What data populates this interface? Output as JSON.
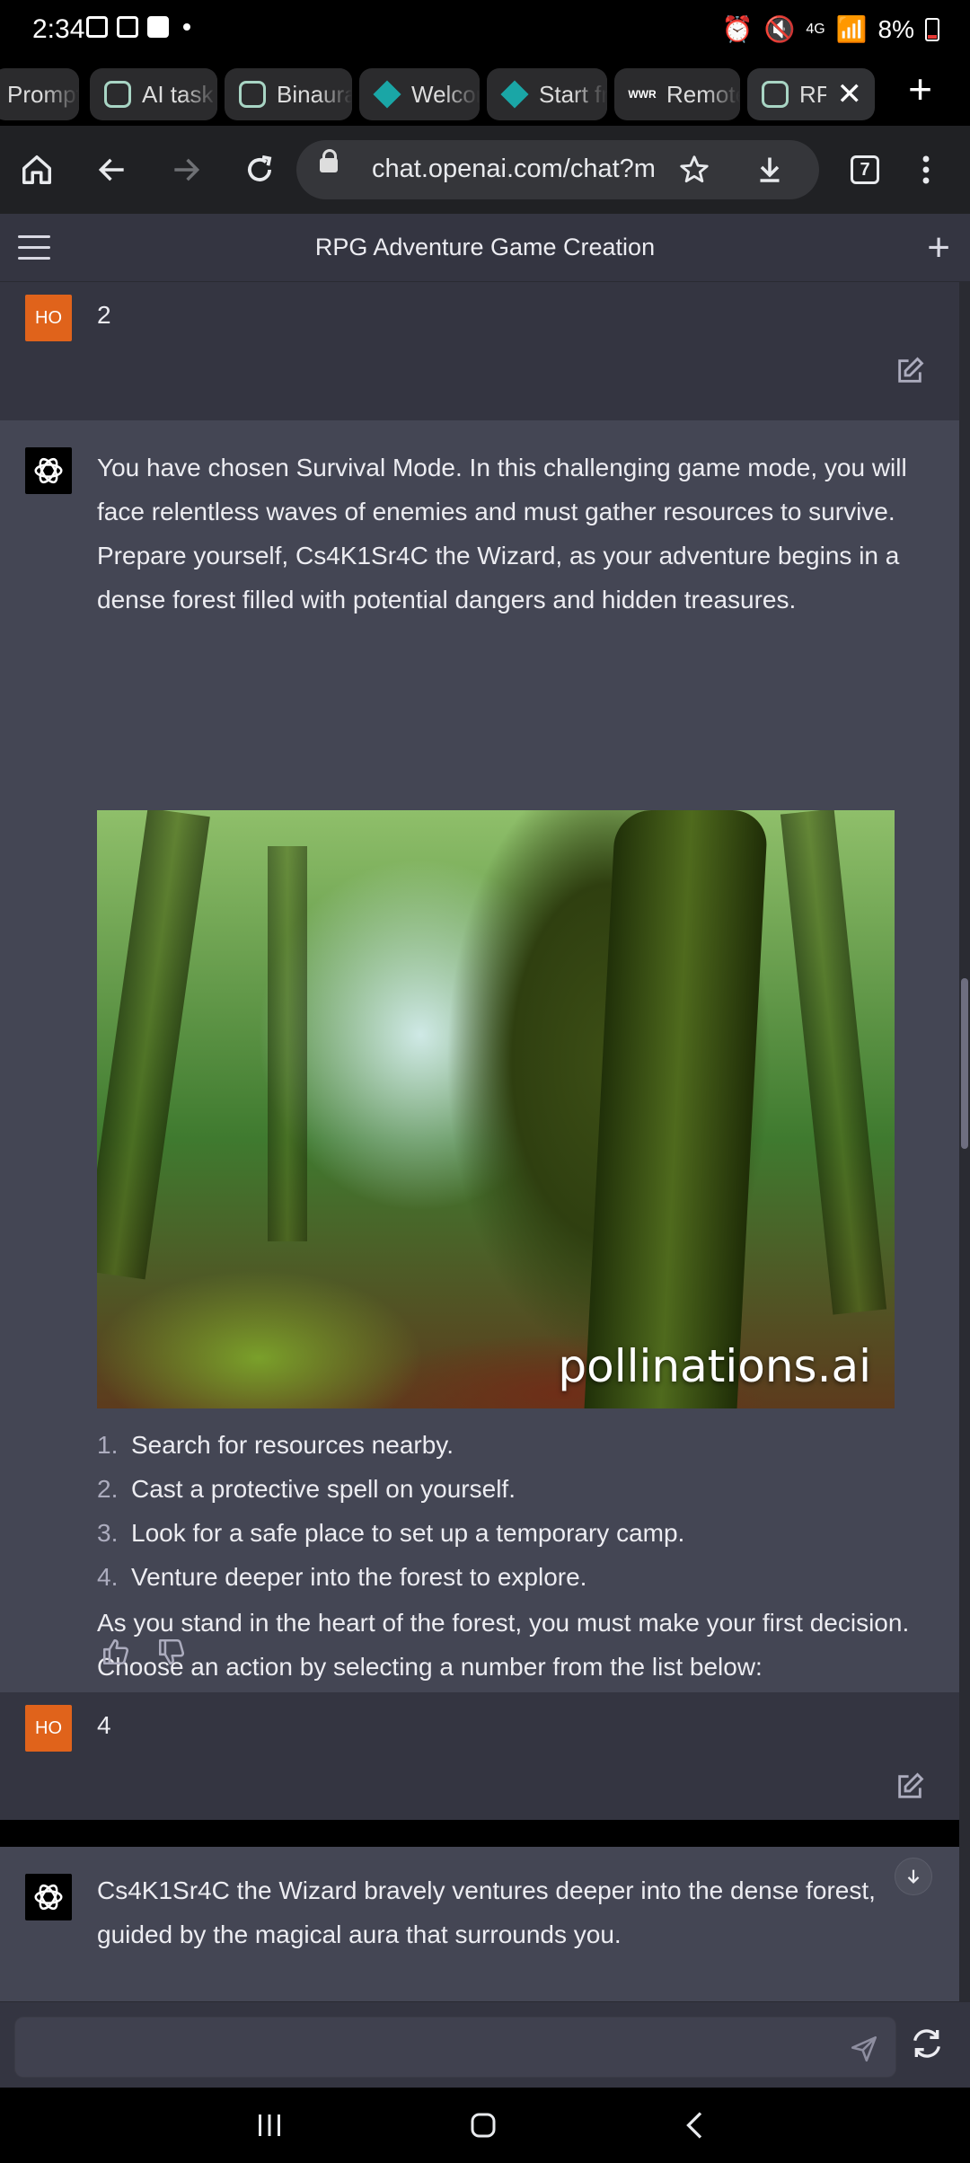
{
  "status_bar": {
    "time": "2:34",
    "network": "4G",
    "battery": "8%"
  },
  "tabs": [
    {
      "title": "Prompt",
      "favicon": "none"
    },
    {
      "title": "AI task",
      "favicon": "chatgpt"
    },
    {
      "title": "Binaural",
      "favicon": "chatgpt"
    },
    {
      "title": "Welcome",
      "favicon": "diamond"
    },
    {
      "title": "Start fr",
      "favicon": "diamond"
    },
    {
      "title": "Remote",
      "favicon": "wwr"
    },
    {
      "title": "RPG",
      "favicon": "chatgpt"
    }
  ],
  "wwr_favicon_text": "WWR",
  "browser": {
    "url": "chat.openai.com/chat?model",
    "tab_count": "7"
  },
  "chat": {
    "title": "RPG Adventure Game Creation",
    "user_avatar": "HO",
    "messages": [
      {
        "role": "user",
        "text": "2"
      },
      {
        "role": "assistant",
        "intro": "You have chosen Survival Mode. In this challenging game mode, you will face relentless waves of enemies and must gather resources to survive. Prepare yourself, Cs4K1Sr4C the Wizard, as your adventure begins in a dense forest filled with potential dangers and hidden treasures.",
        "image_watermark": "pollinations.ai",
        "prompt": "As you stand in the heart of the forest, you must make your first decision. Choose an action by selecting a number from the list below:",
        "choices": [
          {
            "num": "1.",
            "text": "Search for resources nearby."
          },
          {
            "num": "2.",
            "text": "Cast a protective spell on yourself."
          },
          {
            "num": "3.",
            "text": "Look for a safe place to set up a temporary camp."
          },
          {
            "num": "4.",
            "text": "Venture deeper into the forest to explore."
          }
        ]
      },
      {
        "role": "user",
        "text": "4"
      },
      {
        "role": "assistant",
        "text": "Cs4K1Sr4C the Wizard bravely ventures deeper into the dense forest, guided by the magical aura that surrounds you."
      }
    ]
  },
  "input": {
    "placeholder": ""
  },
  "colors": {
    "user_bg": "#343541",
    "assistant_bg": "#444654",
    "avatar_orange": "#e0631b"
  }
}
